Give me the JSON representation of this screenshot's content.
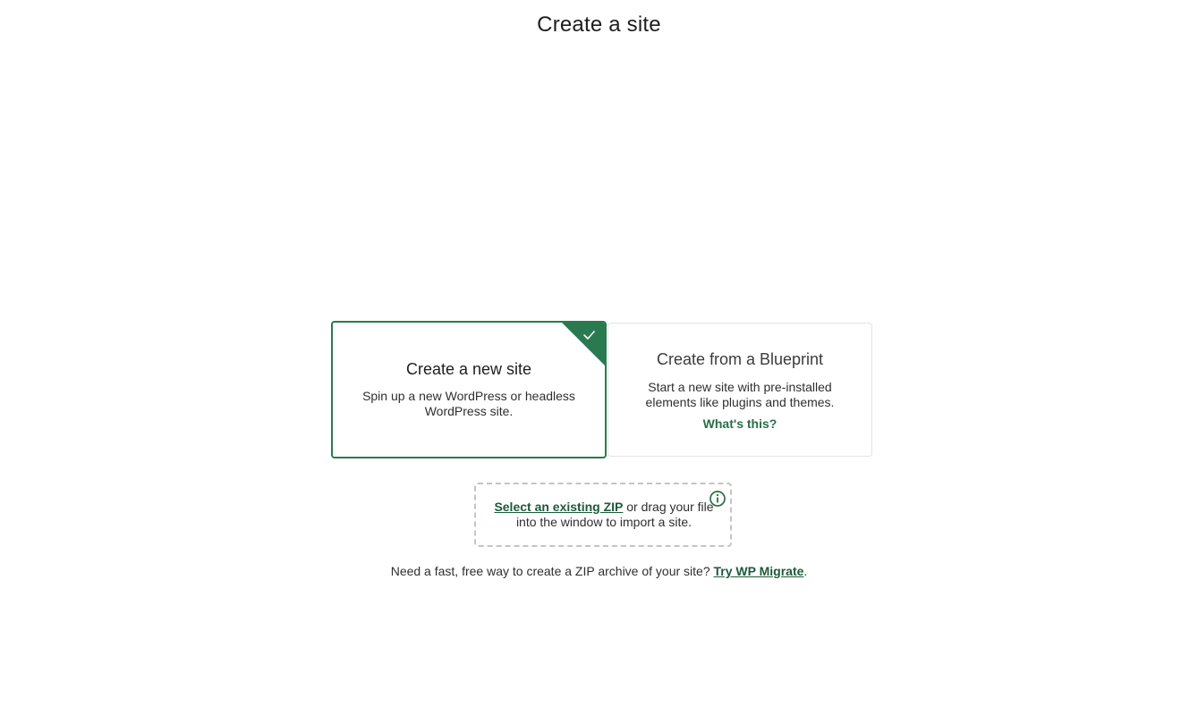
{
  "page": {
    "title": "Create a site"
  },
  "options": {
    "new_site": {
      "title": "Create a new site",
      "description": "Spin up a new WordPress or headless WordPress site.",
      "selected": true,
      "icon": "checkmark-icon"
    },
    "blueprint": {
      "title": "Create from a Blueprint",
      "description": "Start a new site with pre-installed elements like plugins and themes.",
      "link_label": "What's this?"
    }
  },
  "import": {
    "link_label": "Select an existing ZIP",
    "text": " or drag your file into the window to import a site.",
    "icon": "info-icon"
  },
  "footer": {
    "text": "Need a fast, free way to create a ZIP archive of your site? ",
    "link_label": "Try WP Migrate",
    "suffix": "."
  },
  "colors": {
    "accent": "#2a7a4f",
    "link": "#1d5a3a",
    "border": "#e3e3e3",
    "dashed_border": "#c4c4c4"
  }
}
